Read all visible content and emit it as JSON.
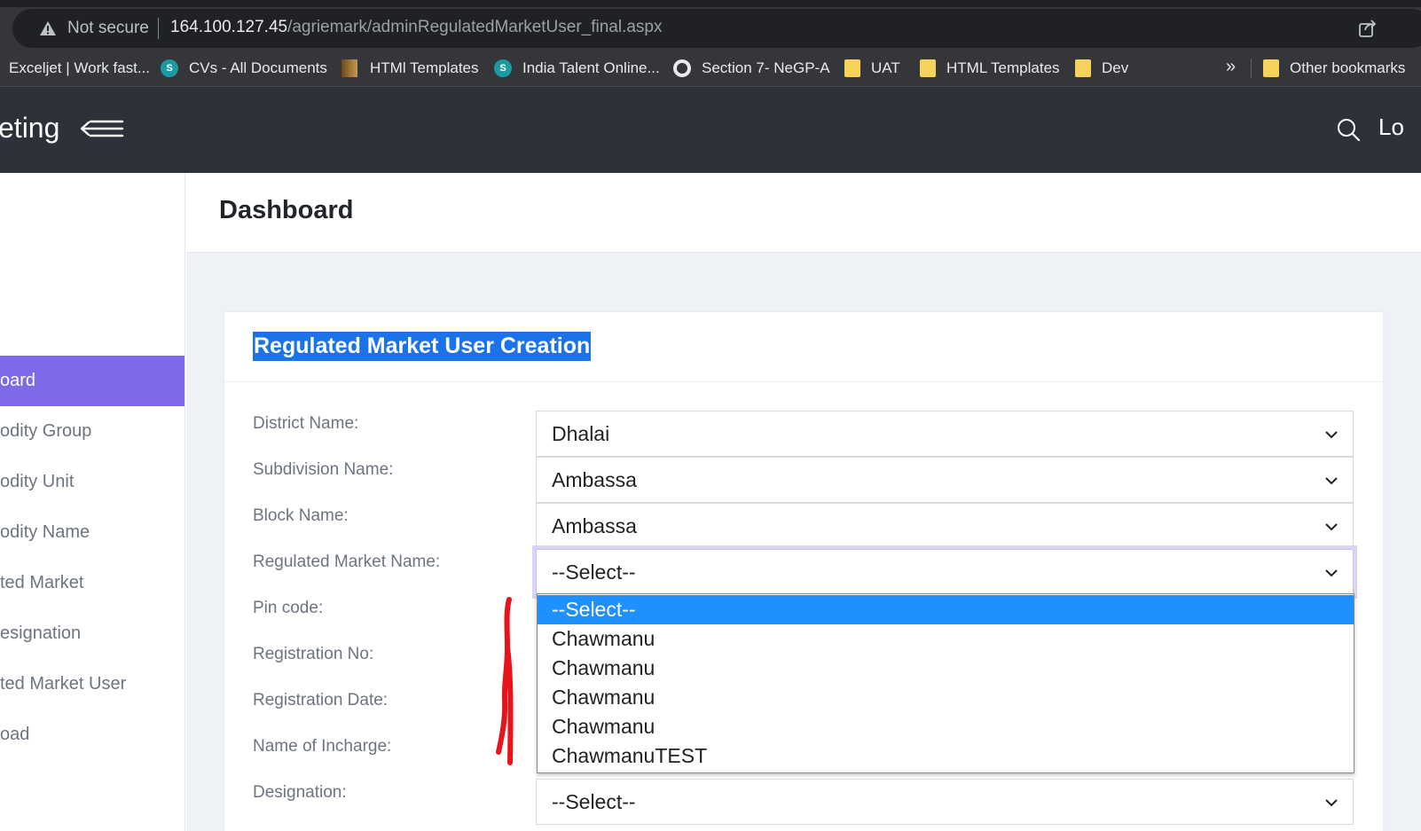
{
  "browser": {
    "security_label": "Not secure",
    "url_host": "164.100.127.45",
    "url_path": "/agriemark/adminRegulatedMarketUser_final.aspx",
    "bookmarks": [
      "Exceljet | Work fast...",
      "CVs - All Documents",
      "HTMl Templates",
      "India Talent Online...",
      "Section 7- NeGP-A",
      "UAT",
      "HTML Templates",
      "Dev"
    ],
    "more_label": "»",
    "other_bookmarks": "Other bookmarks"
  },
  "header": {
    "brand": "eting",
    "right_text": "Lo"
  },
  "sidebar": {
    "items": [
      {
        "label": "oard",
        "active": true
      },
      {
        "label": "odity Group",
        "active": false
      },
      {
        "label": "odity Unit",
        "active": false
      },
      {
        "label": "odity Name",
        "active": false
      },
      {
        "label": "ted Market",
        "active": false
      },
      {
        "label": "esignation",
        "active": false
      },
      {
        "label": "ted Market User",
        "active": false
      },
      {
        "label": "oad",
        "active": false
      }
    ]
  },
  "page": {
    "title": "Dashboard"
  },
  "form": {
    "title": "Regulated Market User Creation",
    "labels": {
      "district": "District Name:",
      "subdivision": "Subdivision Name:",
      "block": "Block Name:",
      "market": "Regulated Market Name:",
      "pincode": "Pin code:",
      "reg_no": "Registration No:",
      "reg_date": "Registration Date:",
      "incharge": "Name of Incharge:",
      "designation": "Designation:"
    },
    "values": {
      "district": "Dhalai",
      "subdivision": "Ambassa",
      "block": "Ambassa",
      "market": "--Select--",
      "designation": "--Select--"
    },
    "market_options": [
      "--Select--",
      "Chawmanu",
      "Chawmanu",
      "Chawmanu",
      "Chawmanu",
      "ChawmanuTEST"
    ]
  },
  "colors": {
    "sidebar_active": "#7c6ae8",
    "header_bg": "#2d313a",
    "selection_highlight": "#1a73e8",
    "option_selected": "#1e90ff",
    "annotation_red": "#e8141c"
  }
}
